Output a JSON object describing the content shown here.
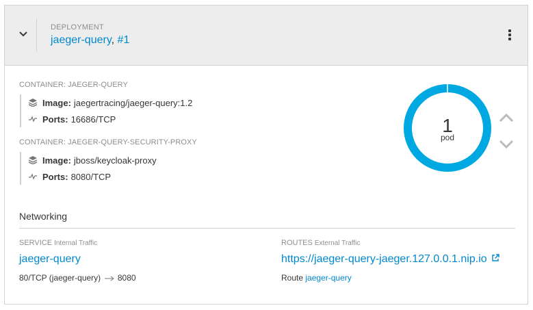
{
  "header": {
    "kind_label": "DEPLOYMENT",
    "name": "jaeger-query",
    "separator": ",",
    "revision": "#1"
  },
  "containers": [
    {
      "label": "CONTAINER: JAEGER-QUERY",
      "image_label": "Image:",
      "image": "jaegertracing/jaeger-query:1.2",
      "ports_label": "Ports:",
      "ports": "16686/TCP"
    },
    {
      "label": "CONTAINER: JAEGER-QUERY-SECURITY-PROXY",
      "image_label": "Image:",
      "image": "jboss/keycloak-proxy",
      "ports_label": "Ports:",
      "ports": "8080/TCP"
    }
  ],
  "pods": {
    "count": "1",
    "label": "pod",
    "ring_color": "#00a8e1"
  },
  "networking": {
    "title": "Networking",
    "service": {
      "label": "SERVICE",
      "sublabel": "Internal Traffic",
      "name": "jaeger-query",
      "port_mapping": "80/TCP (jaeger-query)",
      "target_port": "8080"
    },
    "routes": {
      "label": "ROUTES",
      "sublabel": "External Traffic",
      "url": "https://jaeger-query-jaeger.127.0.0.1.nip.io",
      "route_prefix": "Route",
      "route_name": "jaeger-query"
    }
  },
  "colors": {
    "link": "#0088ce",
    "header_bg": "#ededed",
    "muted": "#8b8d8f"
  },
  "icons": [
    "chevron-down-icon",
    "kebab-menu-icon",
    "layers-icon",
    "pulse-icon",
    "chevron-up-icon",
    "external-link-icon",
    "arrow-right-icon"
  ]
}
